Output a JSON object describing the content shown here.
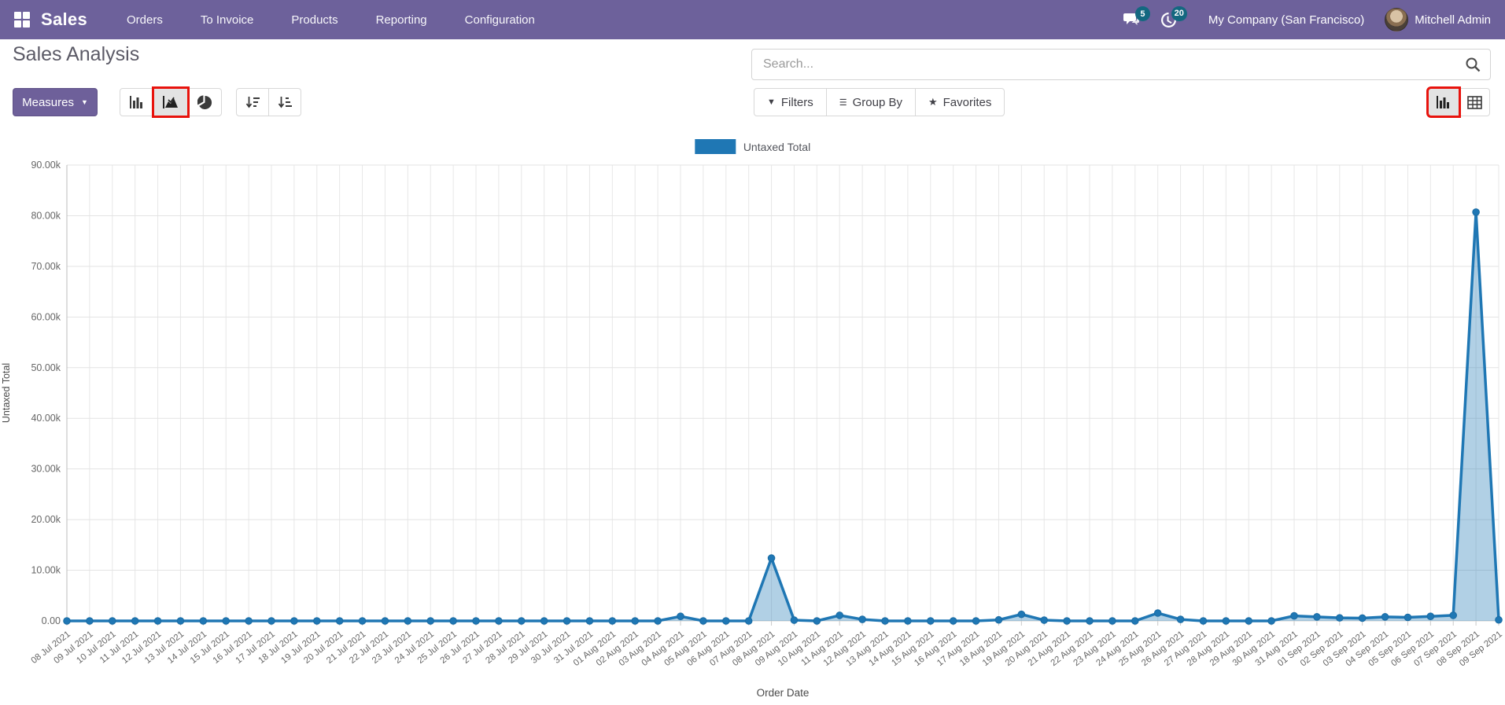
{
  "navbar": {
    "app_name": "Sales",
    "menu": [
      "Orders",
      "To Invoice",
      "Products",
      "Reporting",
      "Configuration"
    ],
    "messages_count": "5",
    "activities_count": "20",
    "company": "My Company (San Francisco)",
    "user": "Mitchell Admin"
  },
  "control_panel": {
    "title": "Sales Analysis",
    "measures_label": "Measures",
    "measures_caret": "▼",
    "search_placeholder": "Search...",
    "filters_label": "Filters",
    "filters_icon_glyph": "▼",
    "group_by_label": "Group By",
    "group_by_icon_glyph": "☰",
    "favorites_label": "Favorites",
    "favorites_icon_glyph": "★"
  },
  "colors": {
    "navbar_bg": "#6d619b",
    "primary_button": "#6e609a",
    "badge": "#146880",
    "highlight_red": "#e8130d",
    "series_blue": "#1f77b4",
    "area_fill_opacity": "0.35",
    "gridline": "#e7e7e7",
    "axis_text": "#666666"
  },
  "chart_data": {
    "type": "area",
    "title": "",
    "legend": [
      "Untaxed Total"
    ],
    "legend_position": "top-center",
    "xlabel": "Order Date",
    "ylabel": "Untaxed Total",
    "ylim": [
      0,
      90000
    ],
    "ytick_labels": [
      "0.00",
      "10.00k",
      "20.00k",
      "30.00k",
      "40.00k",
      "50.00k",
      "60.00k",
      "70.00k",
      "80.00k",
      "90.00k"
    ],
    "grid": true,
    "categories": [
      "08 Jul 2021",
      "09 Jul 2021",
      "10 Jul 2021",
      "11 Jul 2021",
      "12 Jul 2021",
      "13 Jul 2021",
      "14 Jul 2021",
      "15 Jul 2021",
      "16 Jul 2021",
      "17 Jul 2021",
      "18 Jul 2021",
      "19 Jul 2021",
      "20 Jul 2021",
      "21 Jul 2021",
      "22 Jul 2021",
      "23 Jul 2021",
      "24 Jul 2021",
      "25 Jul 2021",
      "26 Jul 2021",
      "27 Jul 2021",
      "28 Jul 2021",
      "29 Jul 2021",
      "30 Jul 2021",
      "31 Jul 2021",
      "01 Aug 2021",
      "02 Aug 2021",
      "03 Aug 2021",
      "04 Aug 2021",
      "05 Aug 2021",
      "06 Aug 2021",
      "07 Aug 2021",
      "08 Aug 2021",
      "09 Aug 2021",
      "10 Aug 2021",
      "11 Aug 2021",
      "12 Aug 2021",
      "13 Aug 2021",
      "14 Aug 2021",
      "15 Aug 2021",
      "16 Aug 2021",
      "17 Aug 2021",
      "18 Aug 2021",
      "19 Aug 2021",
      "20 Aug 2021",
      "21 Aug 2021",
      "22 Aug 2021",
      "23 Aug 2021",
      "24 Aug 2021",
      "25 Aug 2021",
      "26 Aug 2021",
      "27 Aug 2021",
      "28 Aug 2021",
      "29 Aug 2021",
      "30 Aug 2021",
      "31 Aug 2021",
      "01 Sep 2021",
      "02 Sep 2021",
      "03 Sep 2021",
      "04 Sep 2021",
      "05 Sep 2021",
      "06 Sep 2021",
      "07 Sep 2021",
      "08 Sep 2021",
      "09 Sep 2021"
    ],
    "series": [
      {
        "name": "Untaxed Total",
        "values": [
          0,
          0,
          0,
          0,
          0,
          0,
          0,
          0,
          0,
          0,
          0,
          0,
          0,
          0,
          0,
          0,
          0,
          0,
          0,
          0,
          0,
          0,
          0,
          0,
          0,
          0,
          0,
          900,
          0,
          0,
          0,
          12400,
          150,
          0,
          1100,
          300,
          0,
          0,
          0,
          0,
          0,
          200,
          1300,
          150,
          0,
          0,
          0,
          0,
          1550,
          300,
          0,
          0,
          0,
          0,
          1000,
          800,
          600,
          550,
          800,
          700,
          900,
          1100,
          80700,
          200
        ]
      }
    ]
  }
}
